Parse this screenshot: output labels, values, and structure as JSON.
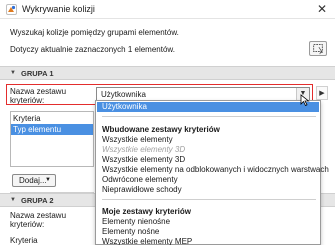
{
  "window": {
    "title": "Wykrywanie kolizji"
  },
  "intro": {
    "description": "Wyszukaj kolizje pomiędzy grupami elementów.",
    "selection_info": "Dotyczy aktualnie zaznaczonych 1 elementów."
  },
  "group1": {
    "header": "GRUPA 1",
    "set_name_label_line1": "Nazwa zestawu",
    "set_name_label_line2": "kryteriów:",
    "set_value": "Użytkownika",
    "criteria_header": "Kryteria",
    "criteria_selected": "Typ elementu",
    "add_button": "Dodaj..."
  },
  "group2": {
    "header": "GRUPA 2",
    "set_name_label_line1": "Nazwa zestawu",
    "set_name_label_line2": "kryteriów:",
    "criteria_header": "Kryteria"
  },
  "dropdown": {
    "selected": "Użytkownika",
    "builtin_heading": "Wbudowane zestawy kryteriów",
    "builtin_items": [
      "Wszystkie elementy",
      "Wszystkie elementy 3D",
      "Wszystkie elementy 3D",
      "Wszystkie elementy na odblokowanych i widocznych warstwach",
      "Odwrócone elementy",
      "Nieprawidłowe schody"
    ],
    "my_heading": "Moje zestawy kryteriów",
    "my_items": [
      "Elementy nienośne",
      "Elementy nośne",
      "Wszystkie elementy MEP"
    ]
  }
}
